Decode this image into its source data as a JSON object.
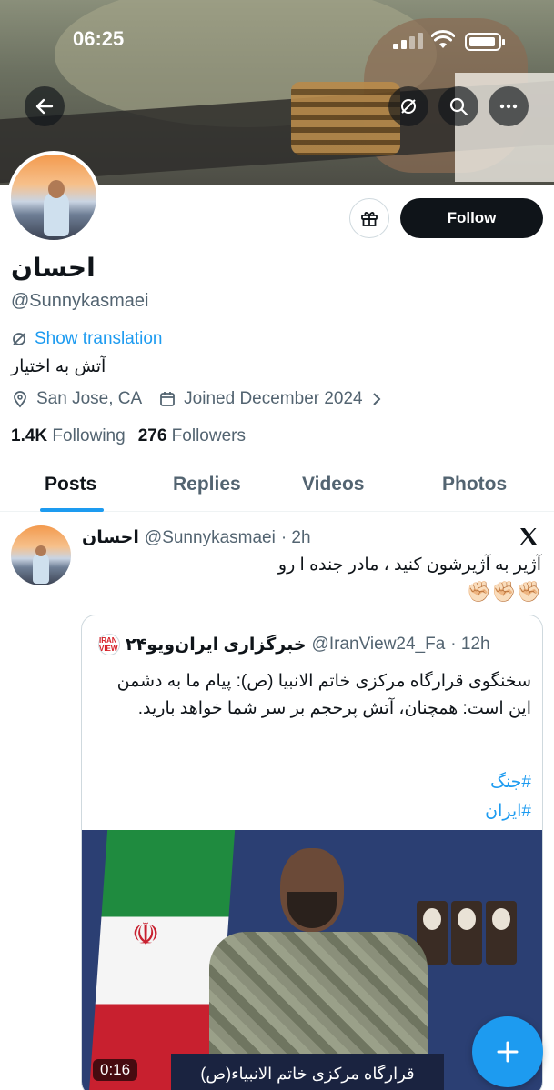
{
  "status_bar": {
    "time": "06:25"
  },
  "profile": {
    "name": "احسان",
    "handle": "@Sunnykasmaei",
    "show_translation": "Show translation",
    "bio": "آتش به اختیار",
    "location": "San Jose, CA",
    "joined": "Joined December 2024",
    "following_count": "1.4K",
    "following_label": "Following",
    "followers_count": "276",
    "followers_label": "Followers",
    "follow_button": "Follow"
  },
  "tabs": [
    {
      "label": "Posts",
      "active": true
    },
    {
      "label": "Replies",
      "active": false
    },
    {
      "label": "Videos",
      "active": false
    },
    {
      "label": "Photos",
      "active": false
    }
  ],
  "post": {
    "author_name": "احسان",
    "author_handle": "@Sunnykasmaei",
    "time": "· 2h",
    "text": "آژیر به آژیرشون کنید ، مادر جنده ا رو",
    "emoji": "✊🏻✊🏻✊🏻",
    "quote": {
      "avatar_text": "IRAN VIEW",
      "author_name": "خبرگزاری ایران‌ویو۲۴",
      "author_handle": "@IranView24_Fa",
      "time": "· 12h",
      "text": "سخنگوی قرارگاه مرکزی خاتم الانبیا (ص): پیام ما به دشمن این است: همچنان، آتش پرحجم بر سر شما خواهد بارید.",
      "hashtag1": "#جنگ",
      "hashtag2": "#ایران",
      "media_caption": "قرارگاه مرکزی خاتم الانبیاء(ص)",
      "duration": "0:16"
    }
  },
  "icons": {
    "back": "arrow-left-icon",
    "translate": "translate-icon",
    "search": "search-icon",
    "more": "more-icon",
    "gift": "gift-icon",
    "location": "location-icon",
    "calendar": "calendar-icon",
    "x_logo": "x-logo-icon",
    "compose": "plus-icon"
  },
  "colors": {
    "accent": "#1d9bf0",
    "text": "#0f1419",
    "secondary": "#536471"
  }
}
